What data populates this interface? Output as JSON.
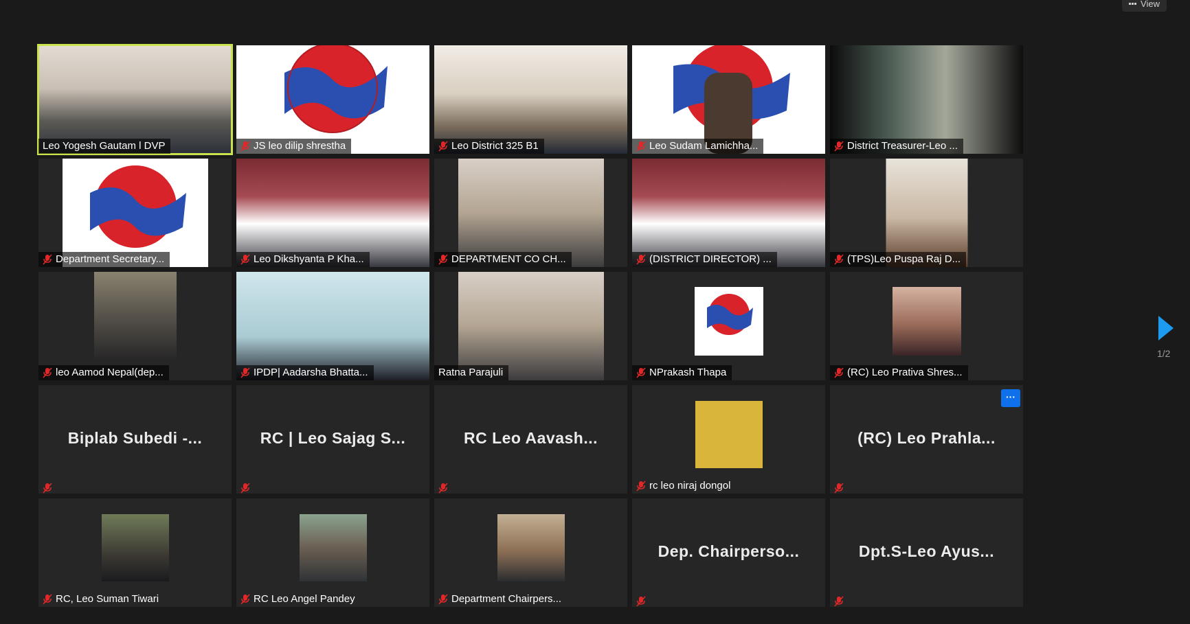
{
  "toolbar": {
    "view_label": "View"
  },
  "pagination": {
    "current": "1/2"
  },
  "participants": [
    {
      "name": "Leo Yogesh Gautam l DVP",
      "muted": false,
      "active_speaker": true,
      "display": "video"
    },
    {
      "name": "JS leo dilip shrestha",
      "muted": true,
      "display": "video"
    },
    {
      "name": "Leo District 325 B1",
      "muted": true,
      "display": "video"
    },
    {
      "name": "Leo Sudam Lamichha...",
      "muted": true,
      "display": "video"
    },
    {
      "name": "District Treasurer-Leo ...",
      "muted": true,
      "display": "video"
    },
    {
      "name": "Department Secretary...",
      "muted": true,
      "display": "video"
    },
    {
      "name": "Leo Dikshyanta P Kha...",
      "muted": true,
      "display": "video"
    },
    {
      "name": "DEPARTMENT CO CH...",
      "muted": true,
      "display": "video"
    },
    {
      "name": "(DISTRICT DIRECTOR) ...",
      "muted": true,
      "display": "video"
    },
    {
      "name": "(TPS)Leo Puspa Raj D...",
      "muted": true,
      "display": "video"
    },
    {
      "name": "leo Aamod Nepal(dep...",
      "muted": true,
      "display": "photo"
    },
    {
      "name": "IPDP| Aadarsha Bhatta...",
      "muted": true,
      "display": "video"
    },
    {
      "name": "Ratna Parajuli",
      "muted": false,
      "display": "video"
    },
    {
      "name": "NPrakash Thapa",
      "muted": true,
      "display": "photo"
    },
    {
      "name": "(RC) Leo Prativa Shres...",
      "muted": true,
      "display": "photo"
    },
    {
      "name": "",
      "display_name": "Biplab Subedi -...",
      "muted": true,
      "display": "name"
    },
    {
      "name": "",
      "display_name": "RC | Leo Sajag S...",
      "muted": true,
      "display": "name"
    },
    {
      "name": "",
      "display_name": "RC Leo Aavash...",
      "muted": true,
      "display": "name"
    },
    {
      "name": "rc leo niraj dongol",
      "muted": true,
      "display": "photo"
    },
    {
      "name": "",
      "display_name": "(RC) Leo Prahla...",
      "muted": true,
      "display": "name",
      "more_button": "···"
    },
    {
      "name": "RC, Leo Suman Tiwari",
      "muted": true,
      "display": "photo"
    },
    {
      "name": "RC Leo Angel Pandey",
      "muted": true,
      "display": "photo"
    },
    {
      "name": "Department Chairpers...",
      "muted": true,
      "display": "photo"
    },
    {
      "name": "",
      "display_name": "Dep. Chairperso...",
      "muted": true,
      "display": "name"
    },
    {
      "name": "",
      "display_name": "Dpt.S-Leo Ayus...",
      "muted": true,
      "display": "name"
    }
  ],
  "colors": {
    "background": "#1a1a1a",
    "tile": "#262626",
    "active_border": "#c9e24e",
    "muted_icon": "#e02828",
    "accent": "#1d9bf0"
  }
}
